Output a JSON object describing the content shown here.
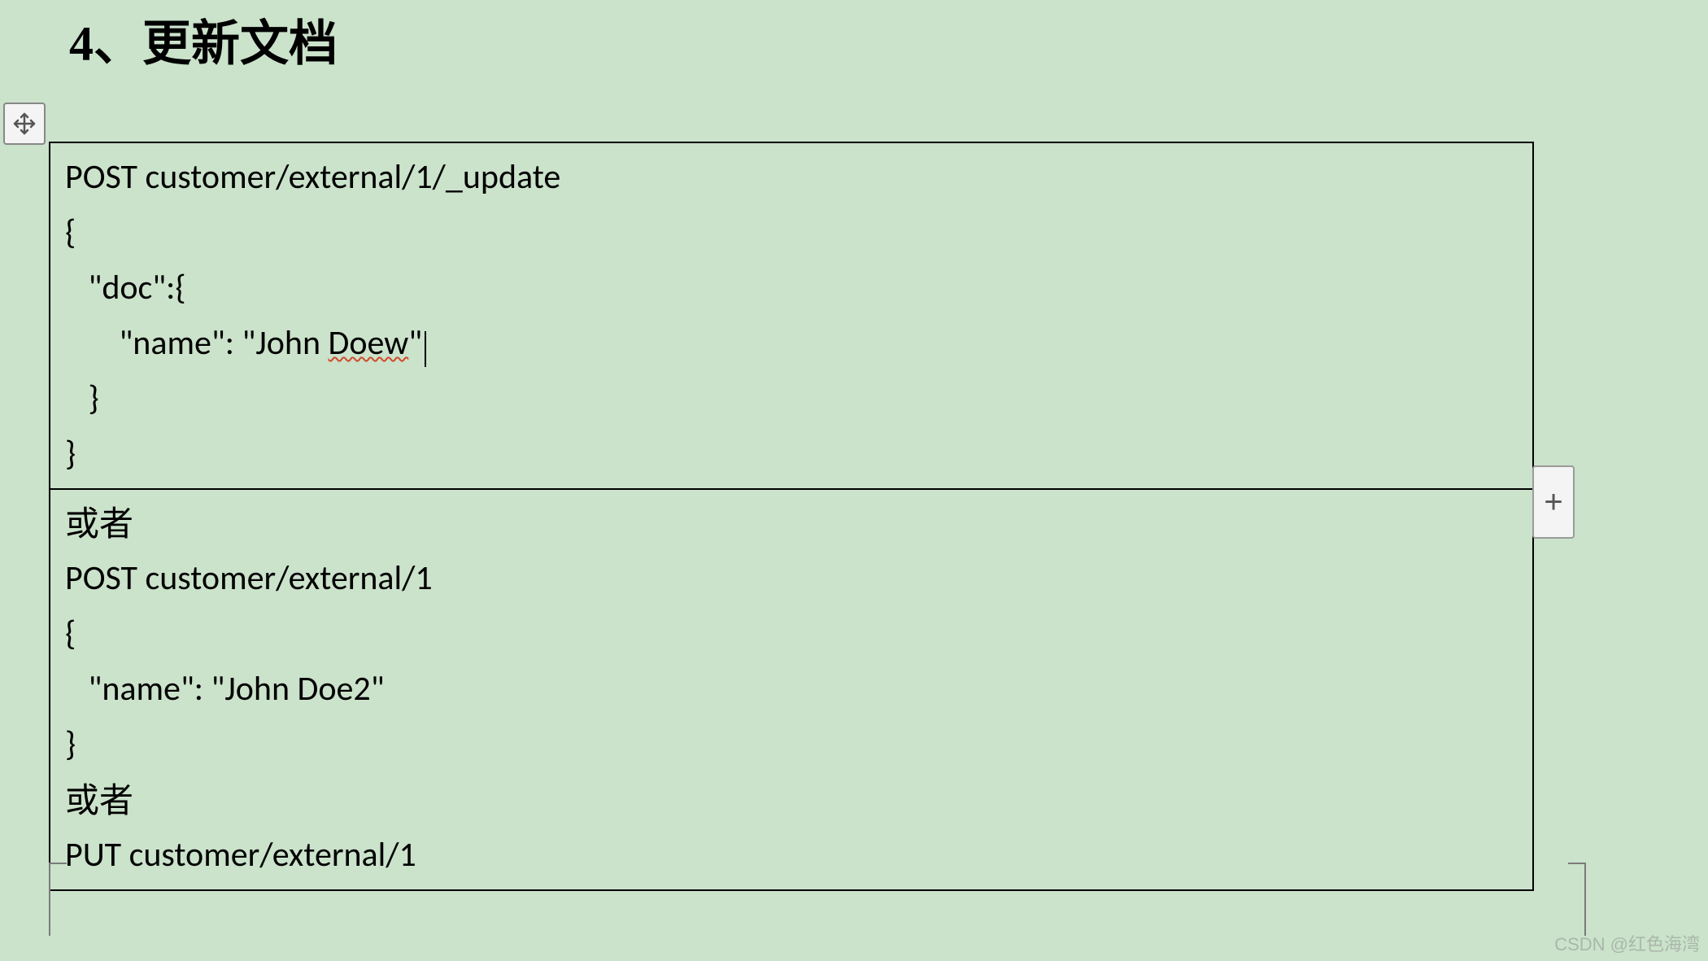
{
  "heading": "4、更新文档",
  "cell1": {
    "l1": "POST customer/external/1/_update",
    "l2": "{",
    "l3": "   \"doc\":{",
    "l4a": "       \"name\": \"John ",
    "l4b": "Doew",
    "l4c": "\"",
    "l5": "   }",
    "l6": "}"
  },
  "cell2": {
    "l1": "或者",
    "l2": "POST customer/external/1",
    "l3": "{",
    "l4": "   \"name\": \"John Doe2\"",
    "l5": "}",
    "l6": "或者",
    "l7": "PUT customer/external/1"
  },
  "addGlyph": "+",
  "watermark": "CSDN @红色海湾"
}
